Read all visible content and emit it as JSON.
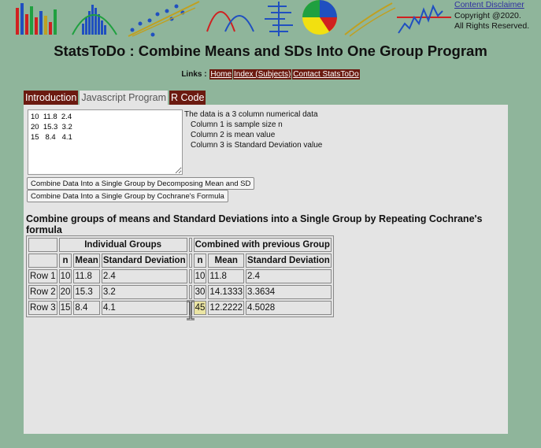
{
  "header": {
    "disclaimer_link": "Content Disclaimer",
    "copyright": "Copyright @2020.",
    "rights": "All Rights Reserved."
  },
  "page_title": "StatsToDo : Combine Means and SDs Into One Group Program",
  "links": {
    "label": "Links :",
    "items": [
      "Home",
      "Index (Subjects)",
      "Contact StatsToDo"
    ]
  },
  "tabs": [
    "Introduction",
    "Javascript Program",
    "R Code"
  ],
  "active_tab": "Javascript Program",
  "input_data": "10  11.8  2.4\n20  15.3  3.2\n15   8.4   4.1",
  "description": {
    "line1": "The data is a 3 column numerical data",
    "line2": "Column 1 is sample size n",
    "line3": "Column 2 is mean value",
    "line4": "Column 3 is Standard Deviation value"
  },
  "buttons": {
    "decompose": "Combine Data Into a Single Group by Decomposing Mean and SD",
    "cochrane": "Combine Data Into a Single Group by Cochrane's Formula"
  },
  "section_title": "Combine groups of means and Standard Deviations into a Single Group by Repeating Cochrane's formula",
  "table": {
    "group_headers": [
      "Individual Groups",
      "Combined with previous Group"
    ],
    "col_headers": [
      "n",
      "Mean",
      "Standard Deviation",
      "n",
      "Mean",
      "Standard Deviation"
    ],
    "rows": [
      {
        "label": "Row 1",
        "n": "10",
        "mean": "11.8",
        "sd": "2.4",
        "cn": "10",
        "cmean": "11.8",
        "csd": "2.4"
      },
      {
        "label": "Row 2",
        "n": "20",
        "mean": "15.3",
        "sd": "3.2",
        "cn": "30",
        "cmean": "14.1333",
        "csd": "3.3634"
      },
      {
        "label": "Row 3",
        "n": "15",
        "mean": "8.4",
        "sd": "4.1",
        "cn": "45",
        "cmean": "12.2222",
        "csd": "4.5028"
      }
    ]
  },
  "colors": {
    "background": "#8fb59b",
    "tab_dark": "#6b1a10",
    "panel": "#e4e4e4"
  }
}
